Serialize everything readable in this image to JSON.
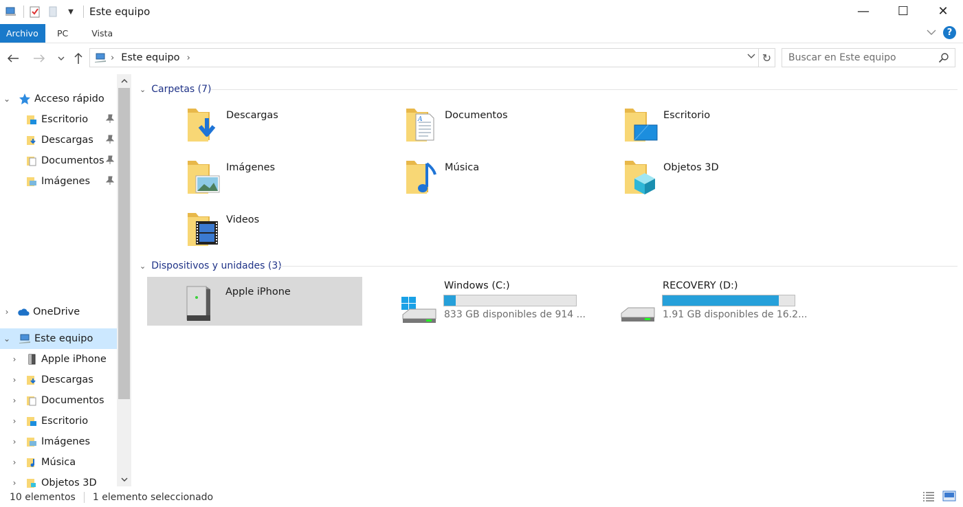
{
  "window": {
    "title": "Este equipo",
    "minimize": "—",
    "maximize": "☐",
    "close": "✕"
  },
  "ribbon": {
    "tabs": [
      "Archivo",
      "PC",
      "Vista"
    ]
  },
  "address": {
    "crumb": "Este equipo"
  },
  "search": {
    "placeholder": "Buscar en Este equipo"
  },
  "nav": {
    "quick_access": "Acceso rápido",
    "quick_items": [
      "Escritorio",
      "Descargas",
      "Documentos",
      "Imágenes"
    ],
    "onedrive": "OneDrive",
    "this_pc": "Este equipo",
    "pc_items": [
      "Apple iPhone",
      "Descargas",
      "Documentos",
      "Escritorio",
      "Imágenes",
      "Música",
      "Objetos 3D"
    ]
  },
  "content": {
    "folders_header": "Carpetas (7)",
    "folders": [
      "Descargas",
      "Documentos",
      "Escritorio",
      "Imágenes",
      "Música",
      "Objetos 3D",
      "Videos"
    ],
    "devices_header": "Dispositivos y unidades (3)",
    "device": {
      "name": "Apple iPhone"
    },
    "drives": [
      {
        "name": "Windows (C:)",
        "free": "833 GB disponibles de 914 ...",
        "used_fraction": 0.09
      },
      {
        "name": "RECOVERY (D:)",
        "free": "1.91 GB disponibles de 16.2...",
        "used_fraction": 0.88
      }
    ]
  },
  "status": {
    "count": "10 elementos",
    "selection": "1 elemento seleccionado"
  },
  "colors": {
    "accent": "#1979ca",
    "selection": "#cce8ff",
    "drive_fill": "#26a0da",
    "folder": "#f8d775"
  }
}
